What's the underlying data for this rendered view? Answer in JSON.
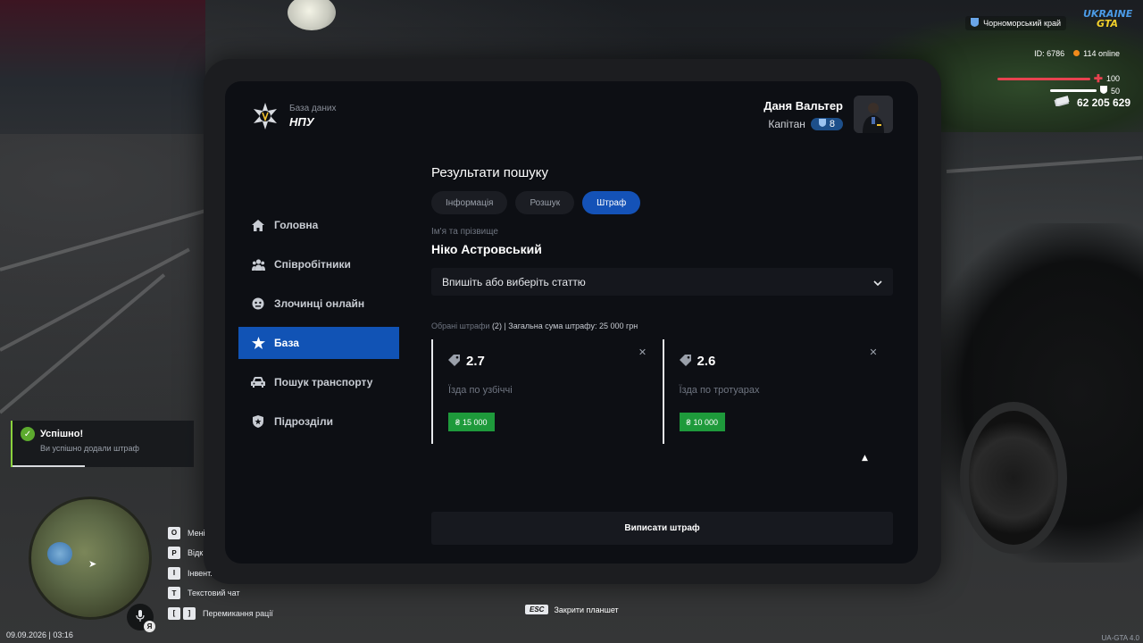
{
  "hud": {
    "region": "Чорноморський край",
    "logo_line1": "UKRAINE",
    "logo_line2": "GTA",
    "id_text": "ID: 6786",
    "online_text": "114 online",
    "health": "100",
    "armor": "50",
    "money": "62 205 629",
    "datetime": "09.09.2026 | 03:16",
    "version": "UA-GTA 4.0"
  },
  "tablet": {
    "logo": {
      "subtitle": "База даних",
      "title": "НПУ"
    },
    "user": {
      "name": "Даня Вальтер",
      "rank": "Капітан",
      "level": "8"
    },
    "nav": [
      {
        "label": "Головна",
        "icon": "home-icon"
      },
      {
        "label": "Співробітники",
        "icon": "staff-icon"
      },
      {
        "label": "Злочинці онлайн",
        "icon": "criminal-icon"
      },
      {
        "label": "База",
        "icon": "star-icon",
        "active": true
      },
      {
        "label": "Пошук транспорту",
        "icon": "car-icon"
      },
      {
        "label": "Підрозділи",
        "icon": "shield-icon"
      }
    ],
    "content": {
      "title": "Результати пошуку",
      "tabs": [
        {
          "label": "Інформація"
        },
        {
          "label": "Розшук"
        },
        {
          "label": "Штраф",
          "active": true
        }
      ],
      "name_label": "Ім'я та прізвище",
      "name_value": "Ніко Астровський",
      "article_select": "Впишіть або виберіть статтю",
      "summary_prefix": "Обрані штрафи",
      "summary_count": "(2)",
      "summary_total": "| Загальна сума штрафу: 25 000 грн",
      "fines": [
        {
          "code": "2.7",
          "description": "Їзда по узбіччі",
          "amount": "15 000"
        },
        {
          "code": "2.6",
          "description": "Їзда по тротуарах",
          "amount": "10 000"
        }
      ],
      "submit_label": "Виписати штраф"
    }
  },
  "toast": {
    "title": "Успішно!",
    "message": "Ви успішно додали штраф",
    "progress": 0.4
  },
  "hotkeys": [
    {
      "key": "O",
      "label": "Мені"
    },
    {
      "key": "P",
      "label": "Відк"
    },
    {
      "key": "I",
      "label": "Інвент."
    },
    {
      "key": "T",
      "label": "Текстовий чат"
    },
    {
      "key1": "[",
      "key2": "]",
      "label": "Перемикання рації"
    }
  ],
  "mic_key": "Я",
  "esc_hint": {
    "key": "ESC",
    "label": "Закрити планшет"
  },
  "colors": {
    "accent": "#1153b5",
    "fine_amount": "#1e9a3b",
    "success": "#8ad13d",
    "health": "#e8424f"
  }
}
